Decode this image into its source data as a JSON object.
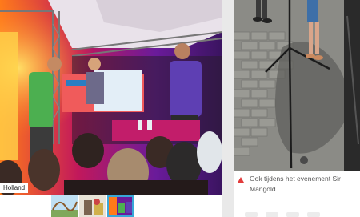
{
  "main_photo": {
    "alt": "",
    "location_tag": "Holland"
  },
  "thumbnails": [
    {
      "name": "thumb-roller-coaster",
      "active": false
    },
    {
      "name": "thumb-ride",
      "active": false
    },
    {
      "name": "thumb-stage",
      "active": true
    }
  ],
  "caption": {
    "text": "Ook tijdens het evenement Sir\nMangold"
  },
  "colors": {
    "accent_red": "#e23b3b",
    "active_thumb_border": "#38a7d8"
  }
}
